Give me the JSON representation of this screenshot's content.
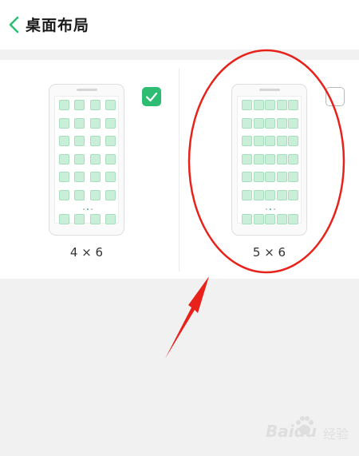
{
  "header": {
    "title": "桌面布局",
    "back_icon": "chevron-left-icon",
    "accent_color": "#2dbd72"
  },
  "layouts": [
    {
      "label": "4 × 6",
      "columns": 4,
      "rows": 6,
      "selected": true
    },
    {
      "label": "5 × 6",
      "columns": 5,
      "rows": 6,
      "selected": false
    }
  ],
  "annotation": {
    "ellipse_color": "#e8211b",
    "arrow_color": "#e8211b"
  },
  "watermark": {
    "brand": "Baidu",
    "sub": "经验"
  }
}
